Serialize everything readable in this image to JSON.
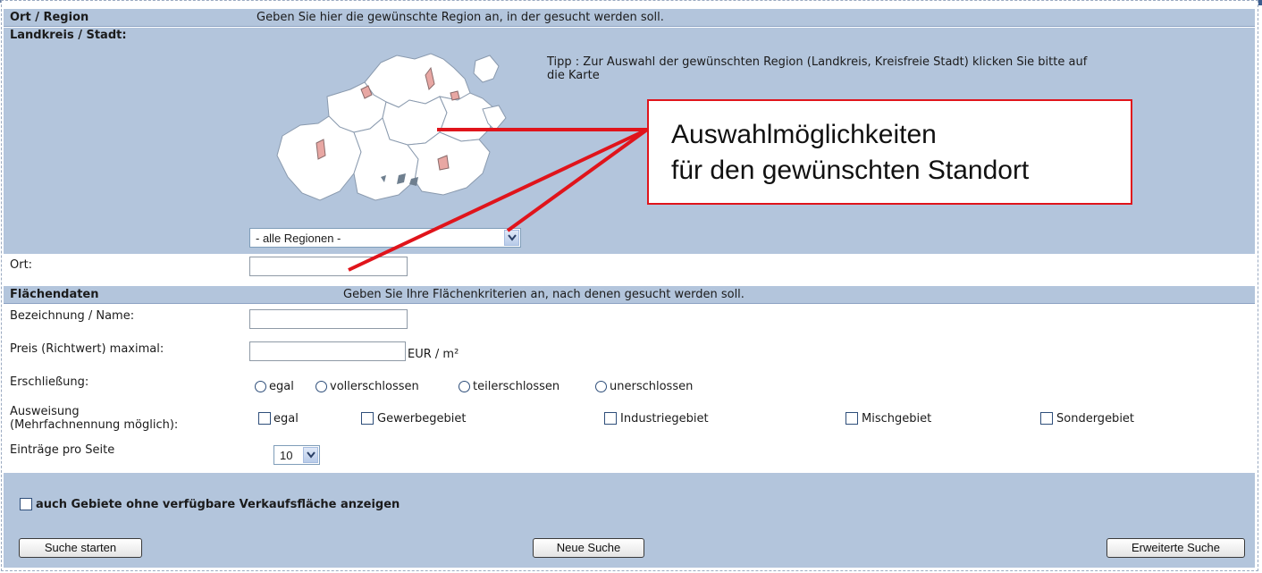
{
  "region_section": {
    "header": "Ort / Region",
    "header_hint": "Geben Sie hier die gewünschte Region an, in der gesucht werden soll.",
    "landkreis_label": "Landkreis / Stadt:",
    "tip": "Tipp : Zur Auswahl der gewünschten Region (Landkreis, Kreisfreie Stadt) klicken Sie bitte auf",
    "tip_line2": "die Karte",
    "region_select_value": "- alle Regionen -",
    "ort_label": "Ort:",
    "ort_value": ""
  },
  "callout": {
    "line1": "Auswahlmöglichkeiten",
    "line2": "für den gewünschten Standort"
  },
  "flaechen_section": {
    "header": "Flächendaten",
    "header_hint": "Geben Sie Ihre Flächenkriterien an, nach denen gesucht werden soll.",
    "name_label": "Bezeichnung / Name:",
    "name_value": "",
    "price_label": "Preis (Richtwert) maximal:",
    "price_value": "",
    "price_unit": "EUR / m²",
    "erschliessung_label": "Erschließung:",
    "erschliessung_options": [
      "egal",
      "vollerschlossen",
      "teilerschlossen",
      "unerschlossen"
    ],
    "ausweisung_label_1": "Ausweisung",
    "ausweisung_label_2": "(Mehrfachnennung möglich):",
    "ausweisung_options": [
      "egal",
      "Gewerbegebiet",
      "Industriegebiet",
      "Mischgebiet",
      "Sondergebiet"
    ],
    "per_page_label": "Einträge pro Seite",
    "per_page_value": "10"
  },
  "footer": {
    "checkbox_label": "auch Gebiete ohne verfügbare Verkaufsfläche anzeigen",
    "btn_search": "Suche starten",
    "btn_new": "Neue Suche",
    "btn_advanced": "Erweiterte Suche"
  },
  "colors": {
    "band": "#b3c5dc",
    "callout_border": "#e0141b",
    "map_fill": "#ffffff",
    "map_highlight": "#e8a7a3"
  }
}
